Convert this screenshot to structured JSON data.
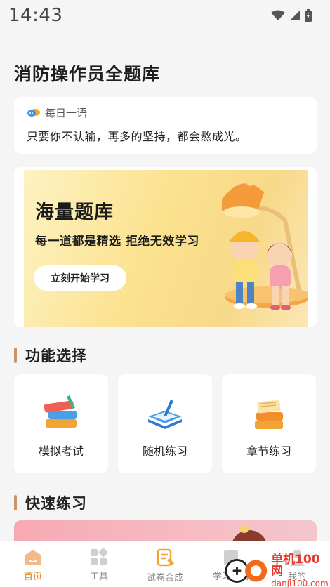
{
  "status_bar": {
    "time": "14:43",
    "icons": [
      "wifi-icon",
      "signal-icon",
      "battery-icon"
    ]
  },
  "page_title": "消防操作员全题库",
  "daily_quote": {
    "heading": "每日一语",
    "text": "只要你不认输，再多的坚持，都会熬成光。",
    "icon": "speech-bubble-icon"
  },
  "banner": {
    "title": "海量题库",
    "subtitle": "每一道都是精选  拒绝无效学习",
    "button_label": "立刻开始学习"
  },
  "features": {
    "heading": "功能选择",
    "items": [
      {
        "label": "模拟考试",
        "icon": "books-stack-icon"
      },
      {
        "label": "随机练习",
        "icon": "notebook-pen-icon"
      },
      {
        "label": "章节练习",
        "icon": "chapter-books-icon"
      }
    ]
  },
  "quick_practice": {
    "heading": "快速练习"
  },
  "tabs": [
    {
      "label": "首页",
      "icon": "home-icon",
      "active": true
    },
    {
      "label": "工具",
      "icon": "grid-icon",
      "active": false
    },
    {
      "label": "试卷合成",
      "icon": "exam-paper-icon",
      "active": false
    },
    {
      "label": "学习报告",
      "icon": "report-icon",
      "active": false
    },
    {
      "label": "我的",
      "icon": "profile-icon",
      "active": false
    }
  ],
  "watermark": {
    "main": "单机100网",
    "sub": "danji100.com"
  },
  "colors": {
    "accent": "#e5841f",
    "section_bar": "#c8956a",
    "background": "#f5f5f5"
  }
}
